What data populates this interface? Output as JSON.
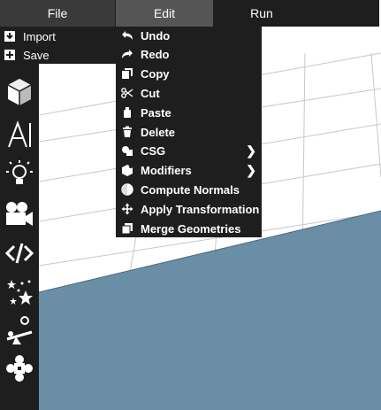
{
  "menubar": {
    "tabs": [
      {
        "label": "File"
      },
      {
        "label": "Edit"
      },
      {
        "label": "Run"
      }
    ]
  },
  "file_menu": {
    "items": [
      {
        "label": "Import",
        "icon": "import-icon"
      },
      {
        "label": "Save",
        "icon": "save-icon"
      }
    ]
  },
  "edit_menu": {
    "items": [
      {
        "label": "Undo",
        "icon": "undo-icon"
      },
      {
        "label": "Redo",
        "icon": "redo-icon"
      },
      {
        "label": "Copy",
        "icon": "copy-icon"
      },
      {
        "label": "Cut",
        "icon": "scissors-icon"
      },
      {
        "label": "Paste",
        "icon": "paste-icon"
      },
      {
        "label": "Delete",
        "icon": "trash-icon"
      },
      {
        "label": "CSG",
        "icon": "csg-icon",
        "submenu": true
      },
      {
        "label": "Modifiers",
        "icon": "modifiers-icon",
        "submenu": true
      },
      {
        "label": "Compute Normals",
        "icon": "half-circle-icon"
      },
      {
        "label": "Apply Transformation",
        "icon": "move-arrows-icon"
      },
      {
        "label": "Merge Geometries",
        "icon": "merge-icon"
      }
    ]
  },
  "sidebar": {
    "tools": [
      "cube-icon",
      "text-icon",
      "lightbulb-icon",
      "camera-icon",
      "code-icon",
      "particles-icon",
      "physics-icon",
      "gamepad-icon"
    ]
  },
  "colors": {
    "menubar_bg": "#1e1e1e",
    "file_tab_bg": "#3a3a3a",
    "edit_tab_bg": "#555555",
    "grid_floor": "#ffffff",
    "ground_plane": "#6a8ea6"
  }
}
